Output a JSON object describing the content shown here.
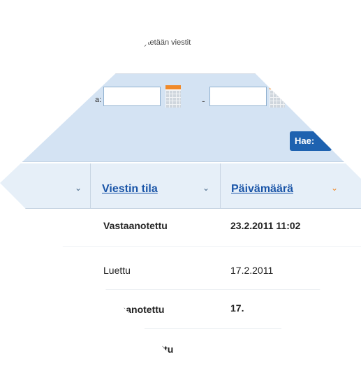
{
  "info": {
    "text": "ytetään viestit"
  },
  "filter": {
    "date_label_suffix": "a:",
    "date_from_value": "",
    "date_to_value": "",
    "range_separator": "-",
    "search_button": "Hae:"
  },
  "table": {
    "columns": [
      {
        "label": "",
        "sort_icon": "⌄"
      },
      {
        "label": "Viestin tila",
        "sort_icon": "⌄"
      },
      {
        "label": "Päivämäärä",
        "sort_icon": "⌄"
      }
    ],
    "rows": [
      {
        "status": "Vastaanotettu",
        "date": "23.2.2011 11:02",
        "bold": true
      },
      {
        "status": "Luettu",
        "date": "17.2.2011",
        "bold": false
      },
      {
        "status": "staanotettu",
        "date": "17.",
        "bold": true
      },
      {
        "status": "tettu",
        "date": "",
        "bold": true
      }
    ]
  },
  "colors": {
    "accent": "#1e62b0",
    "link": "#1a55a8",
    "sort_active": "#f08a2a",
    "filter_bg": "#d4e3f3"
  }
}
